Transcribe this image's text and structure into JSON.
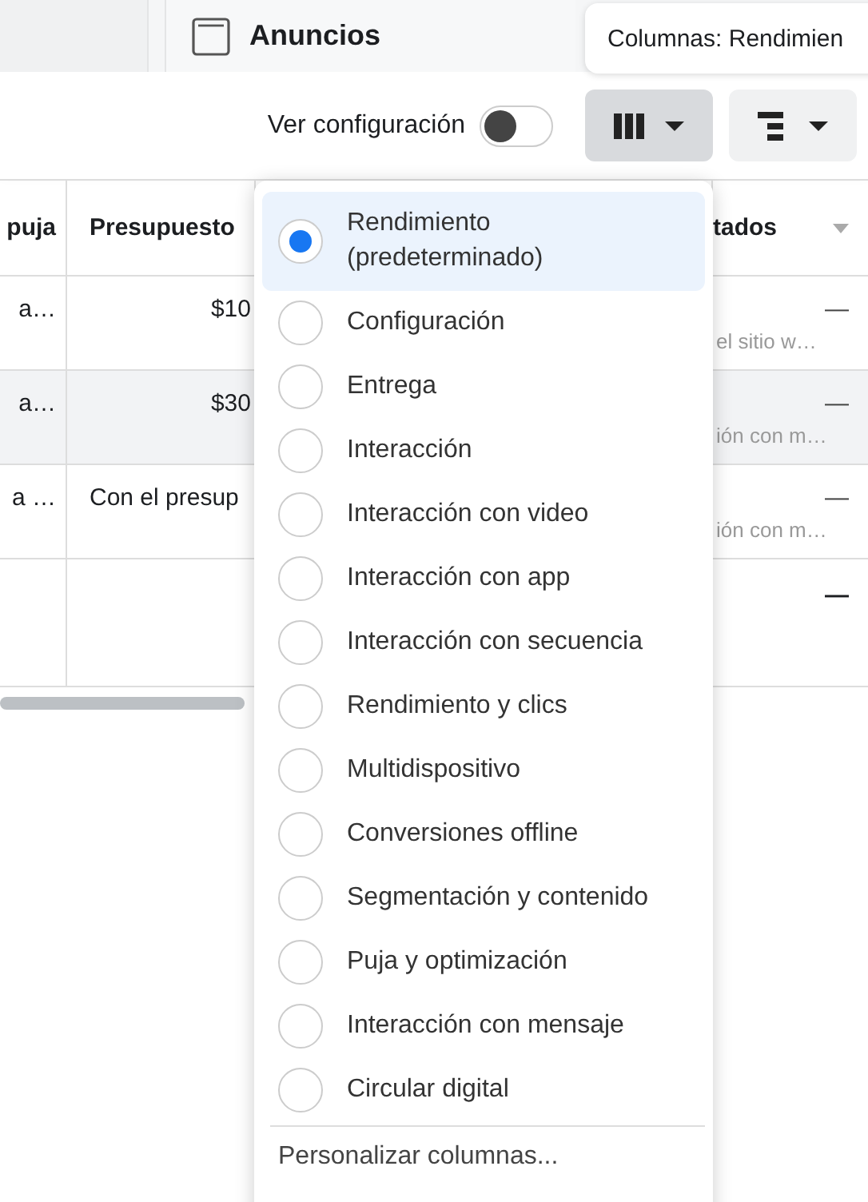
{
  "tab": {
    "title": "Anuncios"
  },
  "tooltip": "Columnas: Rendimien",
  "toolbar": {
    "toggle_label": "Ver configuración",
    "toggle_on": false
  },
  "table": {
    "columns": [
      "puja",
      "Presupuesto",
      "tados"
    ],
    "rows": [
      {
        "column_1": "a…",
        "budget": "$10",
        "column_3_value": "—",
        "column_3_note": "el sitio w…",
        "highlighted": false
      },
      {
        "column_1": "a…",
        "budget": "$30",
        "column_3_value": "—",
        "column_3_note": "ión con m…",
        "highlighted": true
      },
      {
        "column_1": "a …",
        "budget": "Con el presup",
        "column_3_value": "—",
        "column_3_note": "ión con m…",
        "highlighted": false
      }
    ],
    "total": "—"
  },
  "menu": {
    "items": [
      {
        "label": "Rendimiento (predeterminado)",
        "selected": true
      },
      {
        "label": "Configuración",
        "selected": false
      },
      {
        "label": "Entrega",
        "selected": false
      },
      {
        "label": "Interacción",
        "selected": false
      },
      {
        "label": "Interacción con video",
        "selected": false
      },
      {
        "label": "Interacción con app",
        "selected": false
      },
      {
        "label": "Interacción con secuencia",
        "selected": false
      },
      {
        "label": "Rendimiento y clics",
        "selected": false
      },
      {
        "label": "Multidispositivo",
        "selected": false
      },
      {
        "label": "Conversiones offline",
        "selected": false
      },
      {
        "label": "Segmentación y contenido",
        "selected": false
      },
      {
        "label": "Puja y optimización",
        "selected": false
      },
      {
        "label": "Interacción con mensaje",
        "selected": false
      },
      {
        "label": "Circular digital",
        "selected": false
      }
    ],
    "footer": "Personalizar columnas..."
  }
}
